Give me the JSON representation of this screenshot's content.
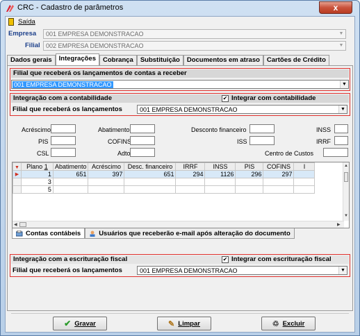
{
  "window": {
    "title": "CRC - Cadastro de parâmetros",
    "close_label": "x"
  },
  "menu": {
    "exit_label": "Saída"
  },
  "empresa": {
    "label": "Empresa",
    "value": "001 EMPRESA DEMONSTRACAO"
  },
  "filial": {
    "label": "Filial",
    "value": "002 EMPRESA DEMONSTRACAO"
  },
  "tabs": [
    {
      "label": "Dados gerais"
    },
    {
      "label": "Integrações"
    },
    {
      "label": "Cobrança"
    },
    {
      "label": "Substituição"
    },
    {
      "label": "Documentos em atraso"
    },
    {
      "label": "Cartões de Crédito"
    }
  ],
  "receber": {
    "header": "Filial que receberá os lançamentos de contas a receber",
    "value": "001 EMPRESA DEMONSTRACAO"
  },
  "contabilidade": {
    "header": "Integração com a contabilidade",
    "checkbox_label": "Integrar com contabilidade",
    "checked": true,
    "filial_label": "Filial que receberá os lançamentos",
    "filial_value": "001 EMPRESA DEMONSTRACAO"
  },
  "fields": {
    "acrescimo": "Acréscimo",
    "abatimento": "Abatimento",
    "desconto": "Desconto financeiro",
    "inss": "INSS",
    "pis": "PIS",
    "cofins": "COFINS",
    "iss": "ISS",
    "irrf": "IRRF",
    "csl": "CSL",
    "adto": "Adto",
    "centro": "Centro de Custos"
  },
  "grid": {
    "columns": [
      "Plano",
      "Abatimento",
      "Acréscimo",
      "Desc. financeiro",
      "IRRF",
      "INSS",
      "PIS",
      "COFINS",
      "I"
    ],
    "sort_marker": "1",
    "rows": [
      [
        "1",
        "651",
        "397",
        "651",
        "294",
        "1126",
        "296",
        "297",
        ""
      ],
      [
        "3",
        "",
        "",
        "",
        "",
        "",
        "",
        "",
        ""
      ],
      [
        "5",
        "",
        "",
        "",
        "",
        "",
        "",
        "",
        ""
      ]
    ]
  },
  "subtabs": [
    {
      "label": "Contas contábeis"
    },
    {
      "label": "Usuários que receberão e-mail após alteração do documento"
    }
  ],
  "fiscal": {
    "header": "Integração com a escrituração fiscal",
    "checkbox_label": "Integrar com escrituração fiscal",
    "checked": true,
    "filial_label": "Filial que receberá os lançamentos",
    "filial_value": "001 EMPRESA DEMONSTRACAO"
  },
  "buttons": {
    "save": "Gravar",
    "clear": "Limpar",
    "delete": "Excluir"
  },
  "colors": {
    "accent": "#1b3f8a",
    "highlight": "#3399ff",
    "red_frame": "#e0302c"
  }
}
